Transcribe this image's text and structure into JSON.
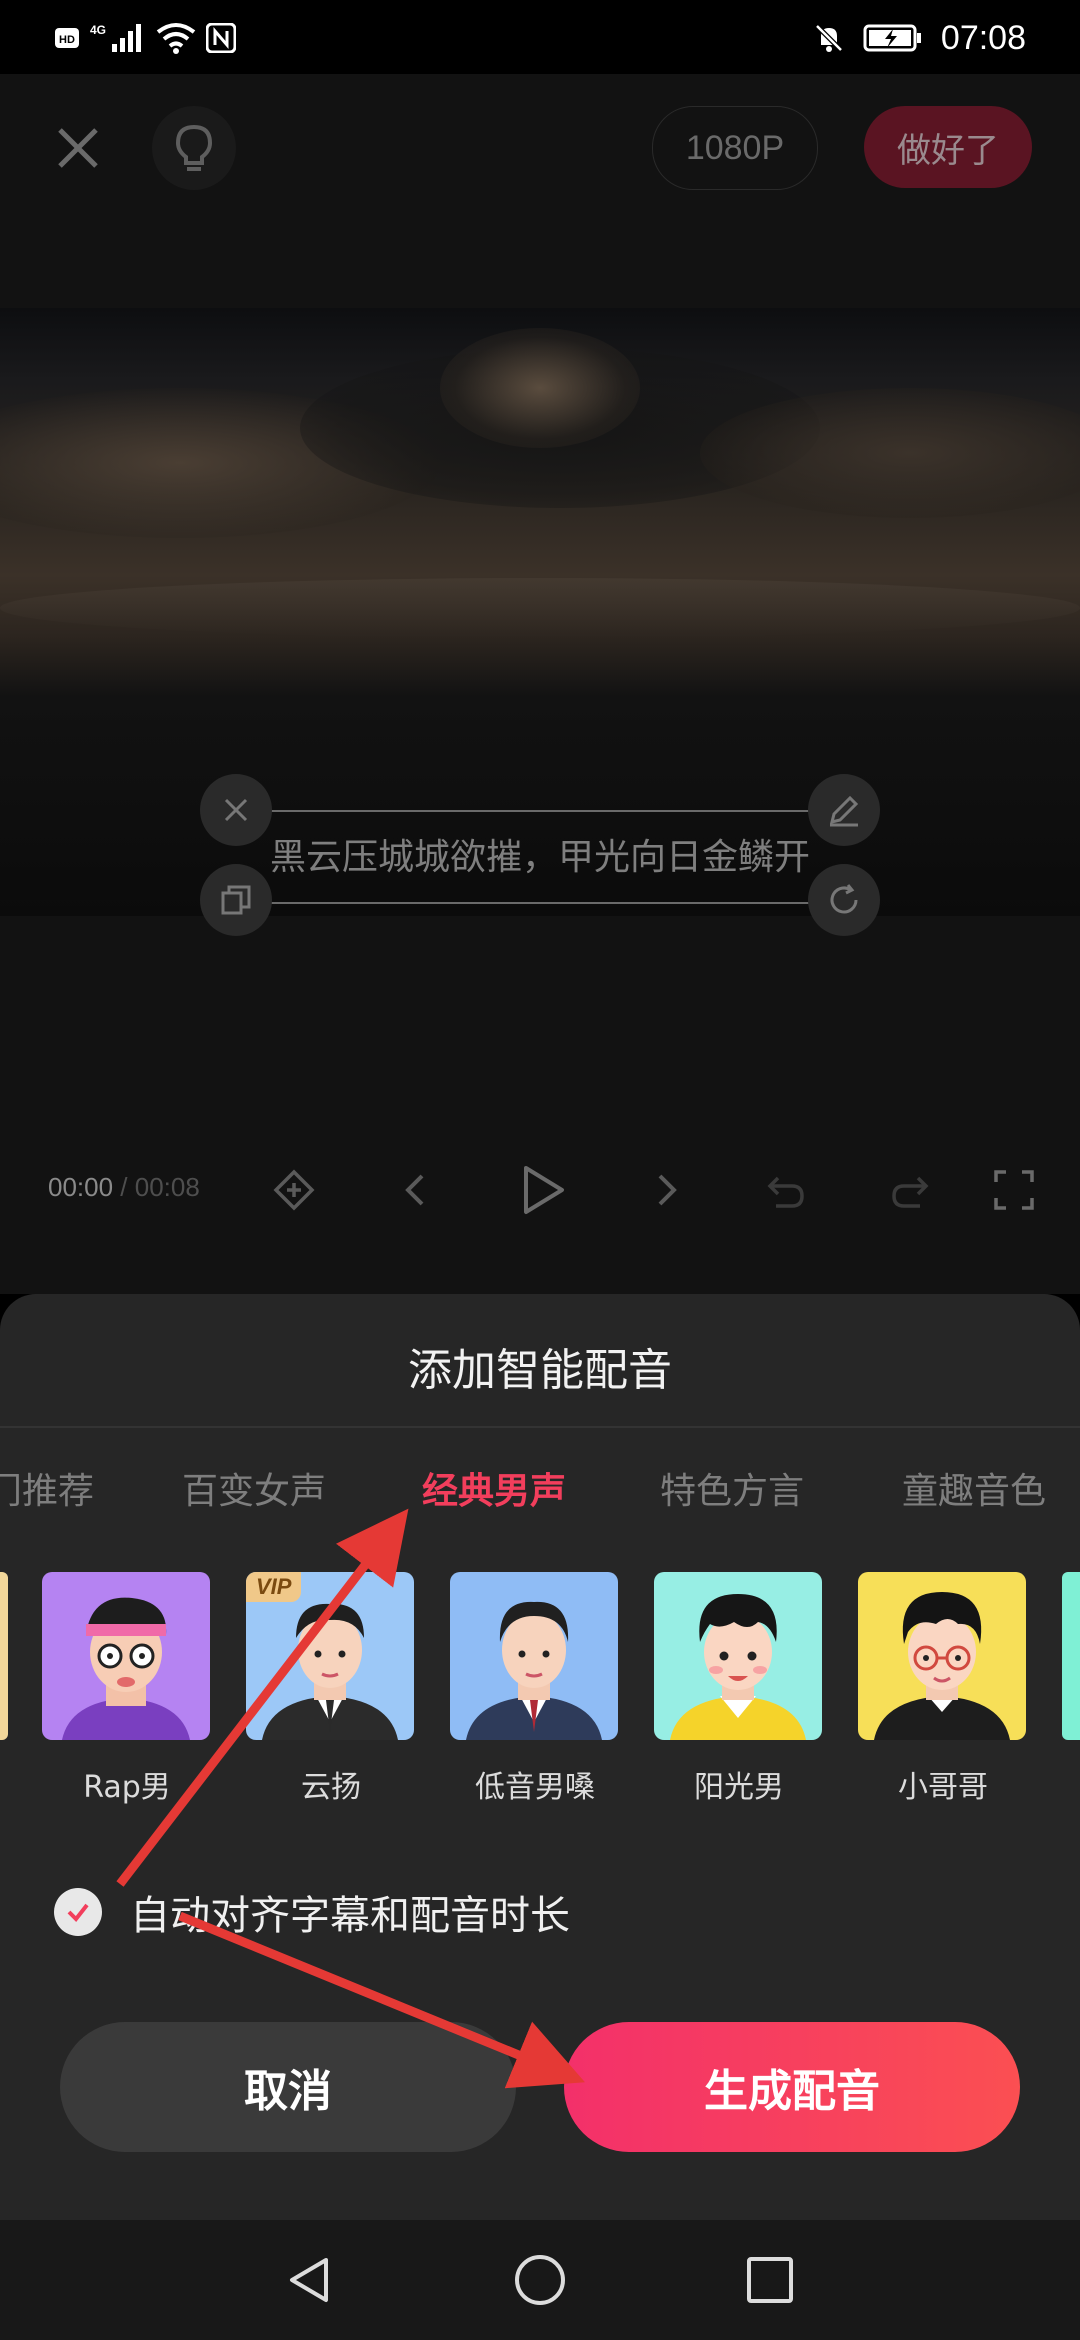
{
  "status_bar": {
    "left_icons": [
      "hd-icon",
      "4g-signal-icon",
      "wifi-icon",
      "nfc-icon"
    ],
    "right_icons": [
      "mute-bell-icon",
      "battery-icon"
    ],
    "time": "07:08"
  },
  "editor": {
    "resolution": "1080P",
    "done_label": "做好了",
    "subtitle": "黑云压城城欲摧，甲光向日金鳞开",
    "time_current": "00:00",
    "time_separator": " / ",
    "time_total": "00:08"
  },
  "sheet": {
    "title": "添加智能配音",
    "tabs": [
      "门推荐",
      "百变女声",
      "经典男声",
      "特色方言",
      "童趣音色"
    ],
    "active_tab": "经典男声",
    "voices": [
      {
        "name": "Rap男",
        "bg": "#b583f2"
      },
      {
        "name": "云扬",
        "bg": "#9cc8f7",
        "badge": "VIP"
      },
      {
        "name": "低音男嗓",
        "bg": "#8fbcf5"
      },
      {
        "name": "阳光男",
        "bg": "#97eee4"
      },
      {
        "name": "小哥哥",
        "bg": "#f7df58"
      }
    ],
    "auto_align_label": "自动对齐字幕和配音时长",
    "auto_align_checked": true,
    "cancel_label": "取消",
    "generate_label": "生成配音"
  },
  "colors": {
    "accent": "#f23e5c",
    "annotation_arrow": "#e53935"
  }
}
